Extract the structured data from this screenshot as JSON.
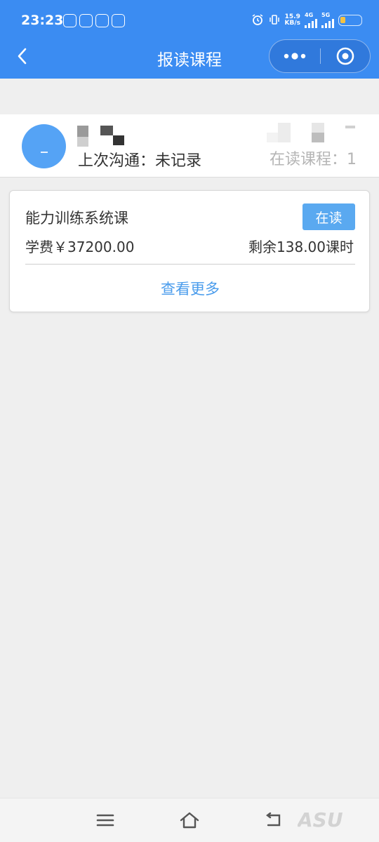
{
  "status_bar": {
    "time": "23:23",
    "network_speed_value": "15.9",
    "network_speed_unit": "KB/s",
    "network_4g": "4G",
    "network_5g": "5G"
  },
  "header": {
    "title": "报读课程",
    "back_icon": "chevron-left-icon",
    "more_icon": "more-dots-icon",
    "target_icon": "target-icon"
  },
  "student": {
    "last_contact": "上次沟通：未记录",
    "reading_courses": "在读课程：1"
  },
  "course": {
    "name": "能力训练系统课",
    "status": "在读",
    "tuition": "学费￥37200.00",
    "remaining": "剩余138.00课时",
    "view_more": "查看更多"
  },
  "colors": {
    "primary": "#3b8cf2",
    "badge": "#5aa9f0",
    "link": "#4a9cec",
    "background": "#efefef"
  },
  "nav": {
    "menu_icon": "menu-icon",
    "home_icon": "home-icon",
    "back_icon": "return-icon"
  }
}
